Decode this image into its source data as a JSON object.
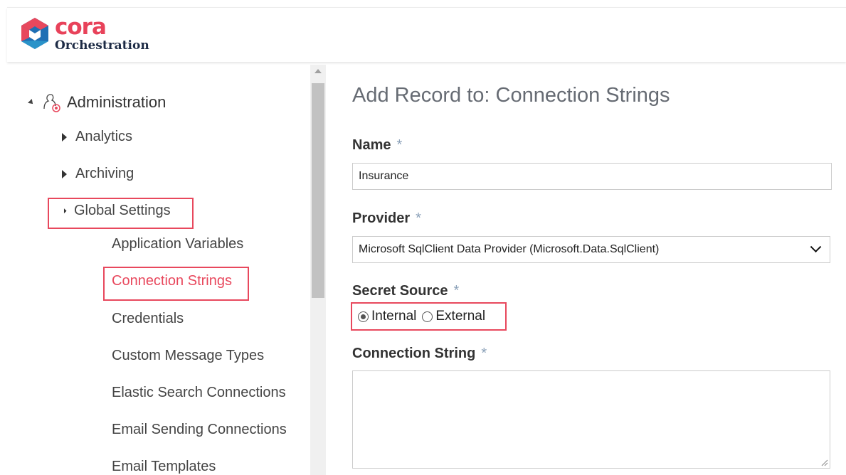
{
  "header": {
    "logo_word": "cora",
    "logo_sub": "Orchestration"
  },
  "sidebar": {
    "root_label": "Administration",
    "items": [
      {
        "label": "Analytics"
      },
      {
        "label": "Archiving"
      },
      {
        "label": "Global Settings"
      }
    ],
    "children": [
      {
        "label": "Application Variables"
      },
      {
        "label": "Connection Strings"
      },
      {
        "label": "Credentials"
      },
      {
        "label": "Custom Message Types"
      },
      {
        "label": "Elastic Search Connections"
      },
      {
        "label": "Email Sending Connections"
      },
      {
        "label": "Email Templates"
      }
    ]
  },
  "form": {
    "title": "Add Record to: Connection Strings",
    "name_label": "Name",
    "name_value": "Insurance",
    "provider_label": "Provider",
    "provider_value": "Microsoft SqlClient Data Provider (Microsoft.Data.SqlClient)",
    "secret_label": "Secret Source",
    "secret_options": [
      "Internal",
      "External"
    ],
    "conn_label": "Connection String",
    "conn_value": "",
    "required_mark": "*"
  }
}
